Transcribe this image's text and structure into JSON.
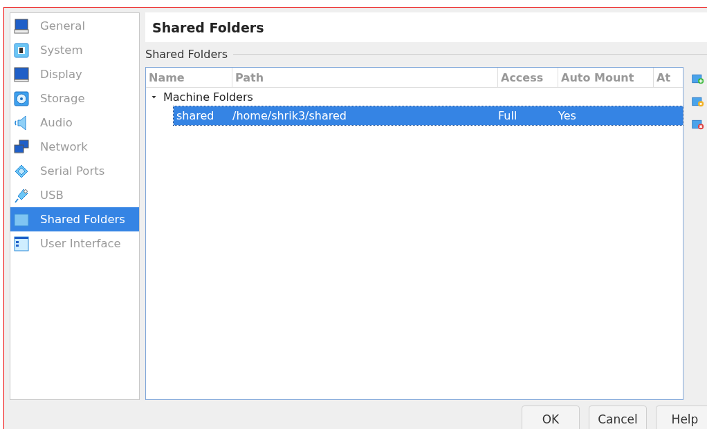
{
  "sidebar": {
    "items": [
      {
        "label": "General",
        "selected": false
      },
      {
        "label": "System",
        "selected": false
      },
      {
        "label": "Display",
        "selected": false
      },
      {
        "label": "Storage",
        "selected": false
      },
      {
        "label": "Audio",
        "selected": false
      },
      {
        "label": "Network",
        "selected": false
      },
      {
        "label": "Serial Ports",
        "selected": false
      },
      {
        "label": "USB",
        "selected": false
      },
      {
        "label": "Shared Folders",
        "selected": true
      },
      {
        "label": "User Interface",
        "selected": false
      }
    ]
  },
  "page_title": "Shared Folders",
  "group_label": "Shared Folders",
  "table": {
    "columns": [
      "Name",
      "Path",
      "Access",
      "Auto Mount",
      "At"
    ],
    "tree": [
      {
        "label": "Machine Folders",
        "expanded": true,
        "children": [
          {
            "cells": [
              "shared",
              "/home/shrik3/shared",
              "Full",
              "Yes",
              ""
            ],
            "selected": true
          }
        ]
      }
    ]
  },
  "buttons": [
    "OK",
    "Cancel",
    "Help"
  ]
}
